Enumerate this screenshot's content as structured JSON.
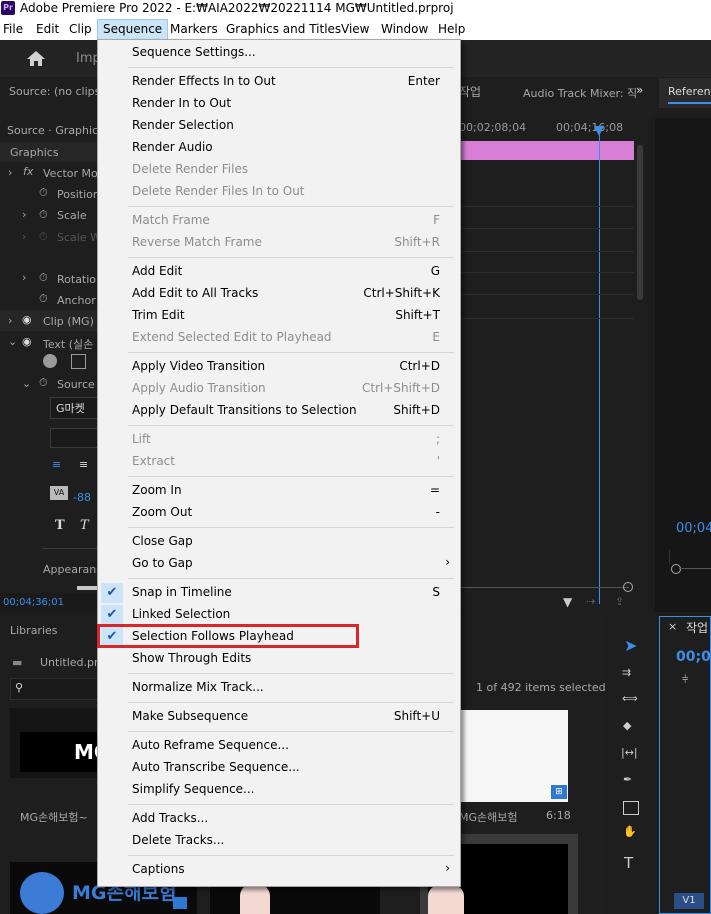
{
  "window": {
    "title": "Adobe Premiere Pro 2022 - E:₩AIA2022₩20221114 MG₩Untitled.prproj",
    "app_icon": "Pr"
  },
  "menubar": [
    "File",
    "Edit",
    "Clip",
    "Sequence",
    "Markers",
    "Graphics and Titles",
    "View",
    "Window",
    "Help"
  ],
  "background": {
    "header": {
      "home_icon": "home-icon",
      "import_label": "Imp"
    },
    "source_panel": {
      "label": "Source: (no clips)",
      "tab_partial": "작업",
      "audio_mixer": "Audio Track Mixer: 직",
      "reference": "Referenc"
    },
    "effect_controls": {
      "source_label": "Source · Graphic",
      "graphics_label": "Graphics",
      "vector_motion": "Vector Mot",
      "position": "Position",
      "scale": "Scale",
      "scale_width": "Scale W",
      "rotation": "Rotation",
      "anchor": "Anchor P",
      "clip_mg": "Clip (MG)",
      "text_layer": "Text (실손",
      "source_text": "Source T",
      "font_text": "G마켓",
      "tracking": "-88",
      "appearance": "Appearanc",
      "timecode": "00;04;36;01"
    },
    "timeline": {
      "time1": "00;02;08;04",
      "time2": "00;04;16;08",
      "timecode_right": "00;04"
    },
    "libraries": {
      "label": "Libraries",
      "project_file": "Untitled.prp",
      "items_selected": "1 of 492 items selected",
      "clip_name_1": "MG손해보험~",
      "clip_name_2": "MG손해보험",
      "duration": "6:18",
      "logo_text": "MG손해보험",
      "thumb_text": "MG"
    },
    "right_panel": {
      "tab": "작업",
      "timecode": "00;0",
      "track": "V1"
    }
  },
  "sequence_menu": [
    {
      "label": "Sequence Settings...",
      "shortcut": "",
      "disabled": false
    },
    {
      "sep": true
    },
    {
      "label": "Render Effects In to Out",
      "shortcut": "Enter",
      "disabled": false
    },
    {
      "label": "Render In to Out",
      "shortcut": "",
      "disabled": false
    },
    {
      "label": "Render Selection",
      "shortcut": "",
      "disabled": false
    },
    {
      "label": "Render Audio",
      "shortcut": "",
      "disabled": false
    },
    {
      "label": "Delete Render Files",
      "shortcut": "",
      "disabled": true
    },
    {
      "label": "Delete Render Files In to Out",
      "shortcut": "",
      "disabled": true
    },
    {
      "sep": true
    },
    {
      "label": "Match Frame",
      "shortcut": "F",
      "disabled": true
    },
    {
      "label": "Reverse Match Frame",
      "shortcut": "Shift+R",
      "disabled": true
    },
    {
      "sep": true
    },
    {
      "label": "Add Edit",
      "shortcut": "G",
      "disabled": false
    },
    {
      "label": "Add Edit to All Tracks",
      "shortcut": "Ctrl+Shift+K",
      "disabled": false
    },
    {
      "label": "Trim Edit",
      "shortcut": "Shift+T",
      "disabled": false
    },
    {
      "label": "Extend Selected Edit to Playhead",
      "shortcut": "E",
      "disabled": true
    },
    {
      "sep": true
    },
    {
      "label": "Apply Video Transition",
      "shortcut": "Ctrl+D",
      "disabled": false
    },
    {
      "label": "Apply Audio Transition",
      "shortcut": "Ctrl+Shift+D",
      "disabled": true
    },
    {
      "label": "Apply Default Transitions to Selection",
      "shortcut": "Shift+D",
      "disabled": false
    },
    {
      "sep": true
    },
    {
      "label": "Lift",
      "shortcut": ";",
      "disabled": true
    },
    {
      "label": "Extract",
      "shortcut": "'",
      "disabled": true
    },
    {
      "sep": true
    },
    {
      "label": "Zoom In",
      "shortcut": "=",
      "disabled": false
    },
    {
      "label": "Zoom Out",
      "shortcut": "-",
      "disabled": false
    },
    {
      "sep": true
    },
    {
      "label": "Close Gap",
      "shortcut": "",
      "disabled": false
    },
    {
      "label": "Go to Gap",
      "shortcut": "",
      "disabled": false,
      "submenu": true
    },
    {
      "sep": true
    },
    {
      "label": "Snap in Timeline",
      "shortcut": "S",
      "disabled": false,
      "checked": true
    },
    {
      "label": "Linked Selection",
      "shortcut": "",
      "disabled": false,
      "checked": true
    },
    {
      "label": "Selection Follows Playhead",
      "shortcut": "",
      "disabled": false,
      "checked": true,
      "highlighted": true
    },
    {
      "label": "Show Through Edits",
      "shortcut": "",
      "disabled": false
    },
    {
      "sep": true
    },
    {
      "label": "Normalize Mix Track...",
      "shortcut": "",
      "disabled": false
    },
    {
      "sep": true
    },
    {
      "label": "Make Subsequence",
      "shortcut": "Shift+U",
      "disabled": false
    },
    {
      "sep": true
    },
    {
      "label": "Auto Reframe Sequence...",
      "shortcut": "",
      "disabled": false
    },
    {
      "label": "Auto Transcribe Sequence...",
      "shortcut": "",
      "disabled": false
    },
    {
      "label": "Simplify Sequence...",
      "shortcut": "",
      "disabled": false
    },
    {
      "sep": true
    },
    {
      "label": "Add Tracks...",
      "shortcut": "",
      "disabled": false
    },
    {
      "label": "Delete Tracks...",
      "shortcut": "",
      "disabled": false
    },
    {
      "sep": true
    },
    {
      "label": "Captions",
      "shortcut": "",
      "disabled": false,
      "submenu": true
    }
  ],
  "colors": {
    "accent": "#3b8eea",
    "highlight_box": "#d9262b",
    "clip_pink": "#d77fd7",
    "menu_bg": "#f2f2f2"
  }
}
